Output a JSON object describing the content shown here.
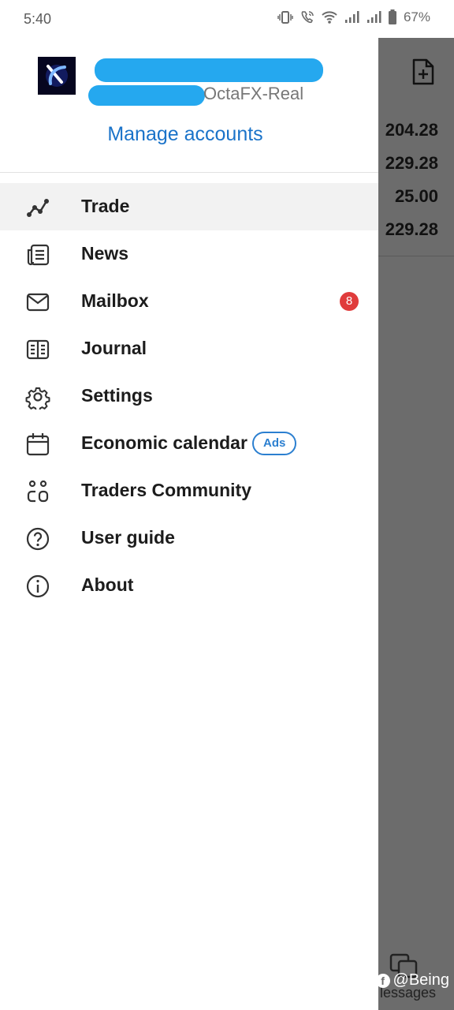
{
  "status_bar": {
    "time": "5:40",
    "battery": "67%",
    "icons": [
      "vibrate-icon",
      "wifi-call-icon",
      "wifi-icon",
      "signal-icon",
      "signal-icon",
      "battery-icon"
    ]
  },
  "background_app": {
    "prices": [
      "204.28",
      "229.28",
      "25.00",
      "229.28"
    ],
    "bottom_label": "lessages",
    "icons": [
      "new-document-icon",
      "copy-icon"
    ]
  },
  "drawer": {
    "account_label": "OctaFX-Real",
    "manage_accounts": "Manage accounts",
    "items": [
      {
        "label": "Trade",
        "icon": "trade-chart-icon",
        "active": true
      },
      {
        "label": "News",
        "icon": "news-icon"
      },
      {
        "label": "Mailbox",
        "icon": "mail-icon",
        "badge": "8"
      },
      {
        "label": "Journal",
        "icon": "journal-icon"
      },
      {
        "label": "Settings",
        "icon": "gear-icon"
      },
      {
        "label": "Economic calendar",
        "icon": "calendar-icon",
        "tag": "Ads"
      },
      {
        "label": "Traders Community",
        "icon": "community-icon"
      },
      {
        "label": "User guide",
        "icon": "help-icon"
      },
      {
        "label": "About",
        "icon": "info-icon"
      }
    ]
  },
  "watermark": "@Being",
  "colors": {
    "accent": "#1a73c9",
    "badge": "#e03c3c",
    "redaction": "#25a8ef",
    "scrim": "#6c6c6c"
  }
}
